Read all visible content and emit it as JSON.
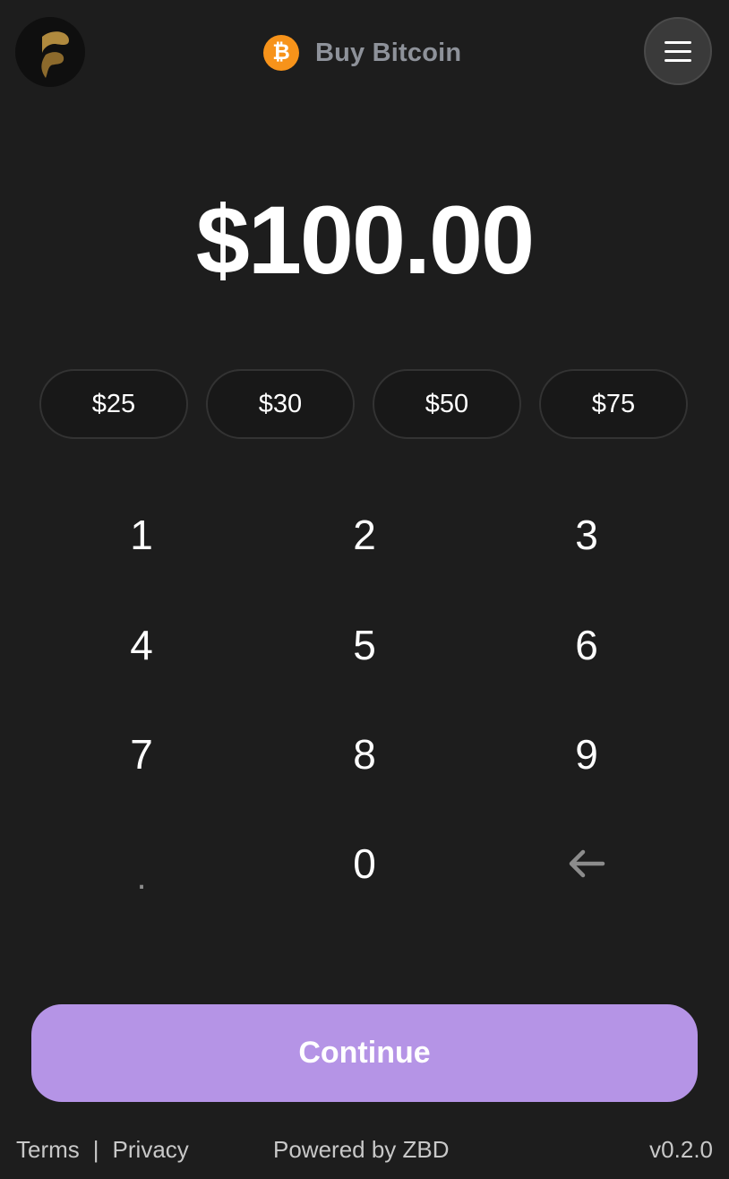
{
  "header": {
    "title": "Buy Bitcoin",
    "btc_symbol": "₿",
    "logo_icon": "brand-logo-icon",
    "menu_icon": "hamburger-menu-icon"
  },
  "amount": {
    "display": "$100.00"
  },
  "presets": [
    {
      "label": "$25"
    },
    {
      "label": "$30"
    },
    {
      "label": "$50"
    },
    {
      "label": "$75"
    }
  ],
  "keypad": {
    "keys": [
      "1",
      "2",
      "3",
      "4",
      "5",
      "6",
      "7",
      "8",
      "9",
      ".",
      "0",
      "←"
    ]
  },
  "continue_button": {
    "label": "Continue"
  },
  "footer": {
    "terms": "Terms",
    "separator": "|",
    "privacy": "Privacy",
    "powered_by": "Powered by ZBD",
    "version": "v0.2.0"
  },
  "colors": {
    "background": "#1d1d1d",
    "accent": "#b594e6",
    "bitcoin": "#f7931a",
    "logo_gold": "#b08a3e"
  }
}
